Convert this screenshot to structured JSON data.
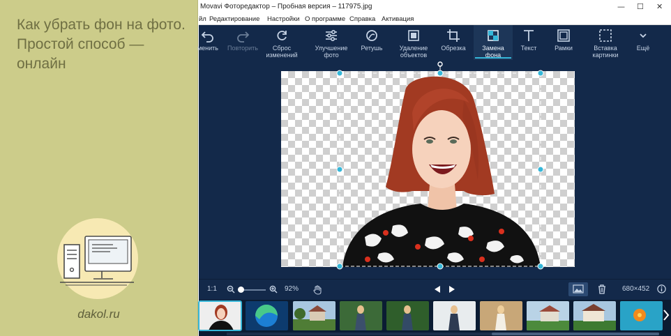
{
  "promo": {
    "title": "Как убрать фон на фото. Простой способ — онлайн",
    "site": "dakol.ru"
  },
  "window": {
    "title": "Movavi Фоторедактор – Пробная версия – 117975.jpg"
  },
  "menu": {
    "items": [
      "йл",
      "Редактирование",
      "Настройки",
      "О программе",
      "Справка",
      "Активация"
    ]
  },
  "toolbar": {
    "items": [
      {
        "label1": "менить",
        "label2": "",
        "icon": "undo-icon"
      },
      {
        "label1": "Повторить",
        "label2": "",
        "icon": "redo-icon"
      },
      {
        "label1": "Сброс",
        "label2": "изменений",
        "icon": "reset-icon"
      },
      {
        "label1": "Улучшение",
        "label2": "фото",
        "icon": "sliders-icon"
      },
      {
        "label1": "Ретушь",
        "label2": "",
        "icon": "retouch-icon"
      },
      {
        "label1": "Удаление",
        "label2": "объектов",
        "icon": "object-removal-icon"
      },
      {
        "label1": "Обрезка",
        "label2": "",
        "icon": "crop-icon"
      },
      {
        "label1": "Замена",
        "label2": "фона",
        "icon": "background-replace-icon"
      },
      {
        "label1": "Текст",
        "label2": "",
        "icon": "text-icon"
      },
      {
        "label1": "Рамки",
        "label2": "",
        "icon": "frame-icon"
      },
      {
        "label1": "Вставка",
        "label2": "картинки",
        "icon": "insert-image-icon"
      },
      {
        "label1": "Ещё",
        "label2": "",
        "icon": "chevron-down-icon"
      }
    ]
  },
  "bottombar": {
    "ratio": "1:1",
    "zoom": "92%",
    "dimensions": "680×452"
  },
  "colors": {
    "app_bg": "#13294a",
    "accent": "#35b7d9",
    "promo_bg": "#cccc8a"
  }
}
